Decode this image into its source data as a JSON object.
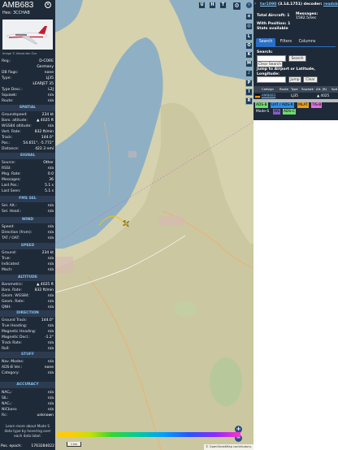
{
  "aircraft": {
    "callsign": "AMB683",
    "hex_label": "Hex: 3CCHAB",
    "close_glyph": "×",
    "photo_credit": "Image © Alexander Zuo"
  },
  "info_rows": [
    {
      "k": "Reg.:",
      "v": "D-CORE"
    },
    {
      "k": "",
      "v": "Germany"
    },
    {
      "k": "DB flags:",
      "v": "none"
    },
    {
      "k": "Type:",
      "v": "LJ35"
    },
    {
      "k": "",
      "v": "LEARJET 35"
    },
    {
      "k": "Type Desc.:",
      "v": "L2J"
    },
    {
      "k": "Squawk:",
      "v": "n/a"
    },
    {
      "k": "Route:",
      "v": "n/a"
    }
  ],
  "sections": {
    "spatial": "SPATIAL",
    "signal": "SIGNAL",
    "fms": "FMS SEL",
    "wind": "WIND",
    "speed": "SPEED",
    "altitude": "ALTITUDE",
    "direction": "DIRECTION",
    "stuff": "STUFF",
    "accuracy": "ACCURACY"
  },
  "spatial_rows": [
    {
      "k": "Groundspeed:",
      "v": "234 kt"
    },
    {
      "k": "Baro. altitude:",
      "v": "▲ 4025 ft"
    },
    {
      "k": "WGS84 altitude:",
      "v": "n/a"
    },
    {
      "k": "Vert. Rate:",
      "v": "832 ft/min"
    },
    {
      "k": "Track:",
      "v": "144.0°"
    },
    {
      "k": "Pos.:",
      "v": "54.651°, -5.772°"
    },
    {
      "k": "Distance:",
      "v": "422.3 nmi"
    }
  ],
  "signal_rows": [
    {
      "k": "Source:",
      "v": "Other"
    },
    {
      "k": "RSSI:",
      "v": "n/a"
    },
    {
      "k": "Msg. Rate:",
      "v": "0.0"
    },
    {
      "k": "Messages:",
      "v": "36"
    },
    {
      "k": "Last Pos.:",
      "v": "5.1 s"
    },
    {
      "k": "Last Seen:",
      "v": "5.1 s"
    }
  ],
  "fms_rows": [
    {
      "k": "Sel. Alt.:",
      "v": "n/a"
    },
    {
      "k": "Sel. Head.:",
      "v": "n/a"
    }
  ],
  "wind_rows": [
    {
      "k": "Speed:",
      "v": "n/a"
    },
    {
      "k": "Direction (from):",
      "v": "n/a"
    },
    {
      "k": "TAT / OAT:",
      "v": "n/a"
    }
  ],
  "speed_rows": [
    {
      "k": "Ground:",
      "v": "234 kt"
    },
    {
      "k": "True:",
      "v": "n/a"
    },
    {
      "k": "Indicated:",
      "v": "n/a"
    },
    {
      "k": "Mach:",
      "v": "n/a"
    }
  ],
  "altitude_rows": [
    {
      "k": "Barometric:",
      "v": "▲ 4025 ft"
    },
    {
      "k": "Baro. Rate:",
      "v": "832 ft/min"
    },
    {
      "k": "Geom. WGS84:",
      "v": "n/a"
    },
    {
      "k": "Geom. Rate:",
      "v": "n/a"
    },
    {
      "k": "QNH:",
      "v": "n/a"
    }
  ],
  "direction_rows": [
    {
      "k": "Ground Track:",
      "v": "144.0°"
    },
    {
      "k": "True Heading:",
      "v": "n/a"
    },
    {
      "k": "Magnetic Heading:",
      "v": "n/a"
    },
    {
      "k": "Magnetic Decl.:",
      "v": "-1.2°"
    },
    {
      "k": "Track Rate:",
      "v": "n/a"
    },
    {
      "k": "Roll:",
      "v": "n/a"
    }
  ],
  "stuff_rows": [
    {
      "k": "Nav. Modes:",
      "v": "n/a"
    },
    {
      "k": "ADS-B Ver.:",
      "v": "none"
    },
    {
      "k": "Category:",
      "v": "n/a"
    }
  ],
  "accuracy_rows": [
    {
      "k": "NACₚ:",
      "v": "n/a"
    },
    {
      "k": "SIL:",
      "v": "n/a"
    },
    {
      "k": "NACᵥ:",
      "v": "n/a"
    },
    {
      "k": "NICbaro:",
      "v": "n/a"
    },
    {
      "k": "Rc:",
      "v": "unknown"
    }
  ],
  "footer_note": "Learn more about Mode S data type by hovering over each data label.",
  "epoch": {
    "k": "Pos. epoch:",
    "v": "1763284022"
  },
  "map_buttons": [
    "U",
    "H",
    "T"
  ],
  "side_buttons": [
    "L",
    "O",
    "K",
    "M",
    "P",
    "I",
    "R"
  ],
  "colorbar_labels": [
    "",
    "",
    "",
    "",
    "",
    "",
    "",
    ""
  ],
  "scale_label": "1 km",
  "attribution": "© OpenStreetMap contributors.",
  "zoom": {
    "in": "+",
    "out": "−"
  },
  "right": {
    "title_link": "tar1090",
    "version": "(3.14.1751)",
    "decoder_label": "decoder:",
    "decoder_value": "readsb",
    "total_label": "Total Aircraft: 1",
    "messages_label": "Messages:",
    "messages_value": "1582.5/sec",
    "with_position": "With Position: 1",
    "stats_link": "Stats available",
    "tabs": [
      "Search",
      "Filters",
      "Columns"
    ],
    "search_label": "Search:",
    "search_button": "Search",
    "clear_search": "Clear Search",
    "jump_label": "Jump to Airport or Latitude, Longitude:",
    "jump_button": "Jump",
    "clear_button": "Clear",
    "columns": [
      "",
      "Callsign",
      "Route",
      "Type",
      "Squawk",
      "Alt. (ft)",
      "Spd"
    ],
    "row": {
      "callsign": "AMB683",
      "type": "LJ35",
      "alt": "▲ 4025"
    },
    "chips": [
      "ADS-B",
      "UAT / ADS-R",
      "MLAT",
      "TIS-B",
      "Mode-S",
      "AIS",
      "ADS-C"
    ]
  },
  "colors": {
    "panel": "#1f2a38",
    "section": "#7fc0f5",
    "accent": "#2a6fc7",
    "aircraft": "#f0c020",
    "track": "#f5c400"
  }
}
